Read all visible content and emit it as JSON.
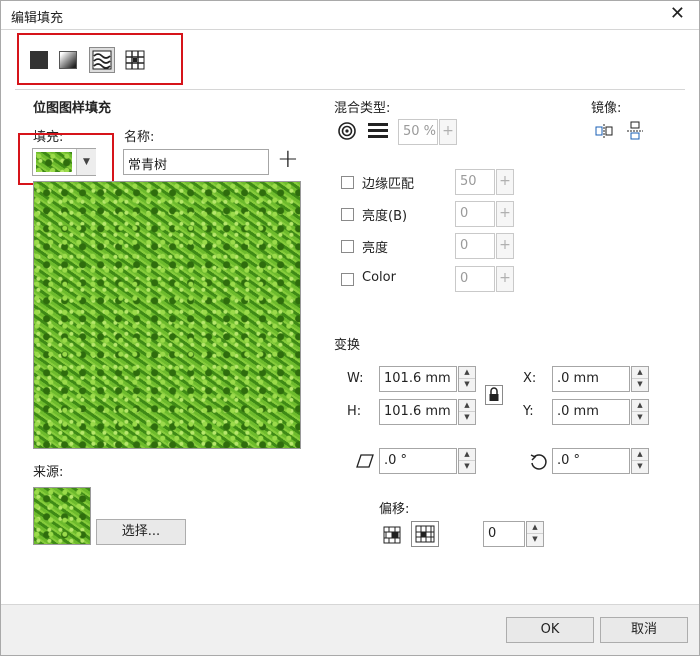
{
  "window": {
    "title": "编辑填充",
    "close_glyph": "✕"
  },
  "fill_types": [
    {
      "name": "uniform-fill",
      "icon": "solid-square-icon"
    },
    {
      "name": "gradient-fill",
      "icon": "gradient-square-icon"
    },
    {
      "name": "bitmap-pattern-fill",
      "icon": "bitmap-pattern-icon"
    },
    {
      "name": "two-color-pattern-fill",
      "icon": "pattern-grid-icon"
    }
  ],
  "section_title": "位图图样填充",
  "fill": {
    "label": "填充:"
  },
  "name": {
    "label": "名称:",
    "value": "常青树",
    "add_glyph": "+"
  },
  "source": {
    "label": "来源:",
    "select_button": "选择..."
  },
  "blend": {
    "label": "混合类型:",
    "opacity": "50 %"
  },
  "mirror": {
    "label": "镜像:"
  },
  "options": [
    {
      "label": "边缘匹配",
      "value": "50",
      "checked": false
    },
    {
      "label": "亮度(B)",
      "value": "0",
      "checked": false
    },
    {
      "label": "亮度",
      "value": "0",
      "checked": false
    },
    {
      "label": "Color",
      "value": "0",
      "checked": false
    }
  ],
  "transform": {
    "label": "变换",
    "w_label": "W:",
    "w_value": "101.6 mm",
    "h_label": "H:",
    "h_value": "101.6 mm",
    "x_label": "X:",
    "x_value": ".0 mm",
    "y_label": "Y:",
    "y_value": ".0 mm",
    "skew_value": ".0 °",
    "rotate_value": ".0 °"
  },
  "offset": {
    "label": "偏移:",
    "value": "0"
  },
  "buttons": {
    "ok": "OK",
    "cancel": "取消"
  },
  "colors": {
    "highlight_box": "#d6141a",
    "grass": "#4f9c1e"
  }
}
